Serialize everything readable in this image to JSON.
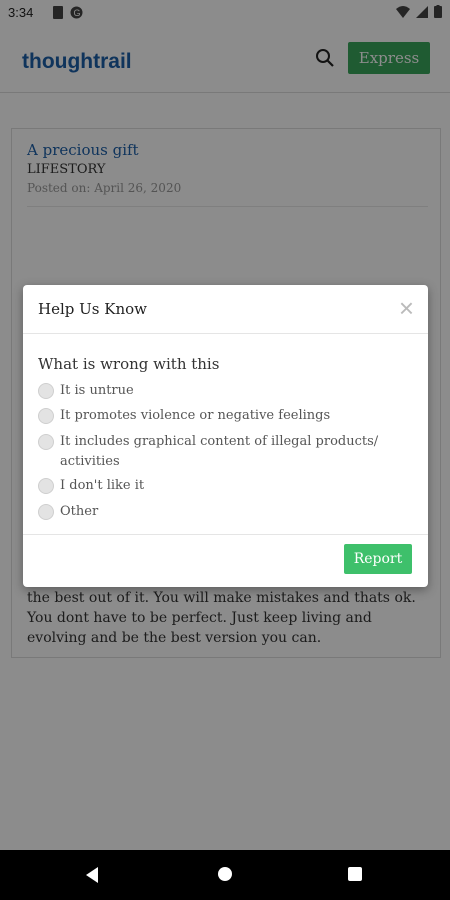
{
  "status_bar": {
    "time": "3:34"
  },
  "app": {
    "brand": "thoughtrail",
    "express_label": "Express"
  },
  "post": {
    "title": "A precious gift",
    "category": "LIFESTORY",
    "posted_on": "Posted on: April 26, 2020",
    "body": "the best out of it. You will make mistakes and thats ok. You dont have to be perfect. Just keep living and evolving and be the best version you can."
  },
  "modal": {
    "title": "Help Us Know",
    "close_symbol": "×",
    "question": "What is wrong with this",
    "options": [
      "It is untrue",
      "It promotes violence or negative feelings",
      "It includes graphical content of illegal products/ activities",
      "I don't like it",
      "Other"
    ],
    "report_label": "Report"
  },
  "colors": {
    "brand": "#1d5fa8",
    "express": "#3aa65b",
    "report": "#3ec06b"
  }
}
